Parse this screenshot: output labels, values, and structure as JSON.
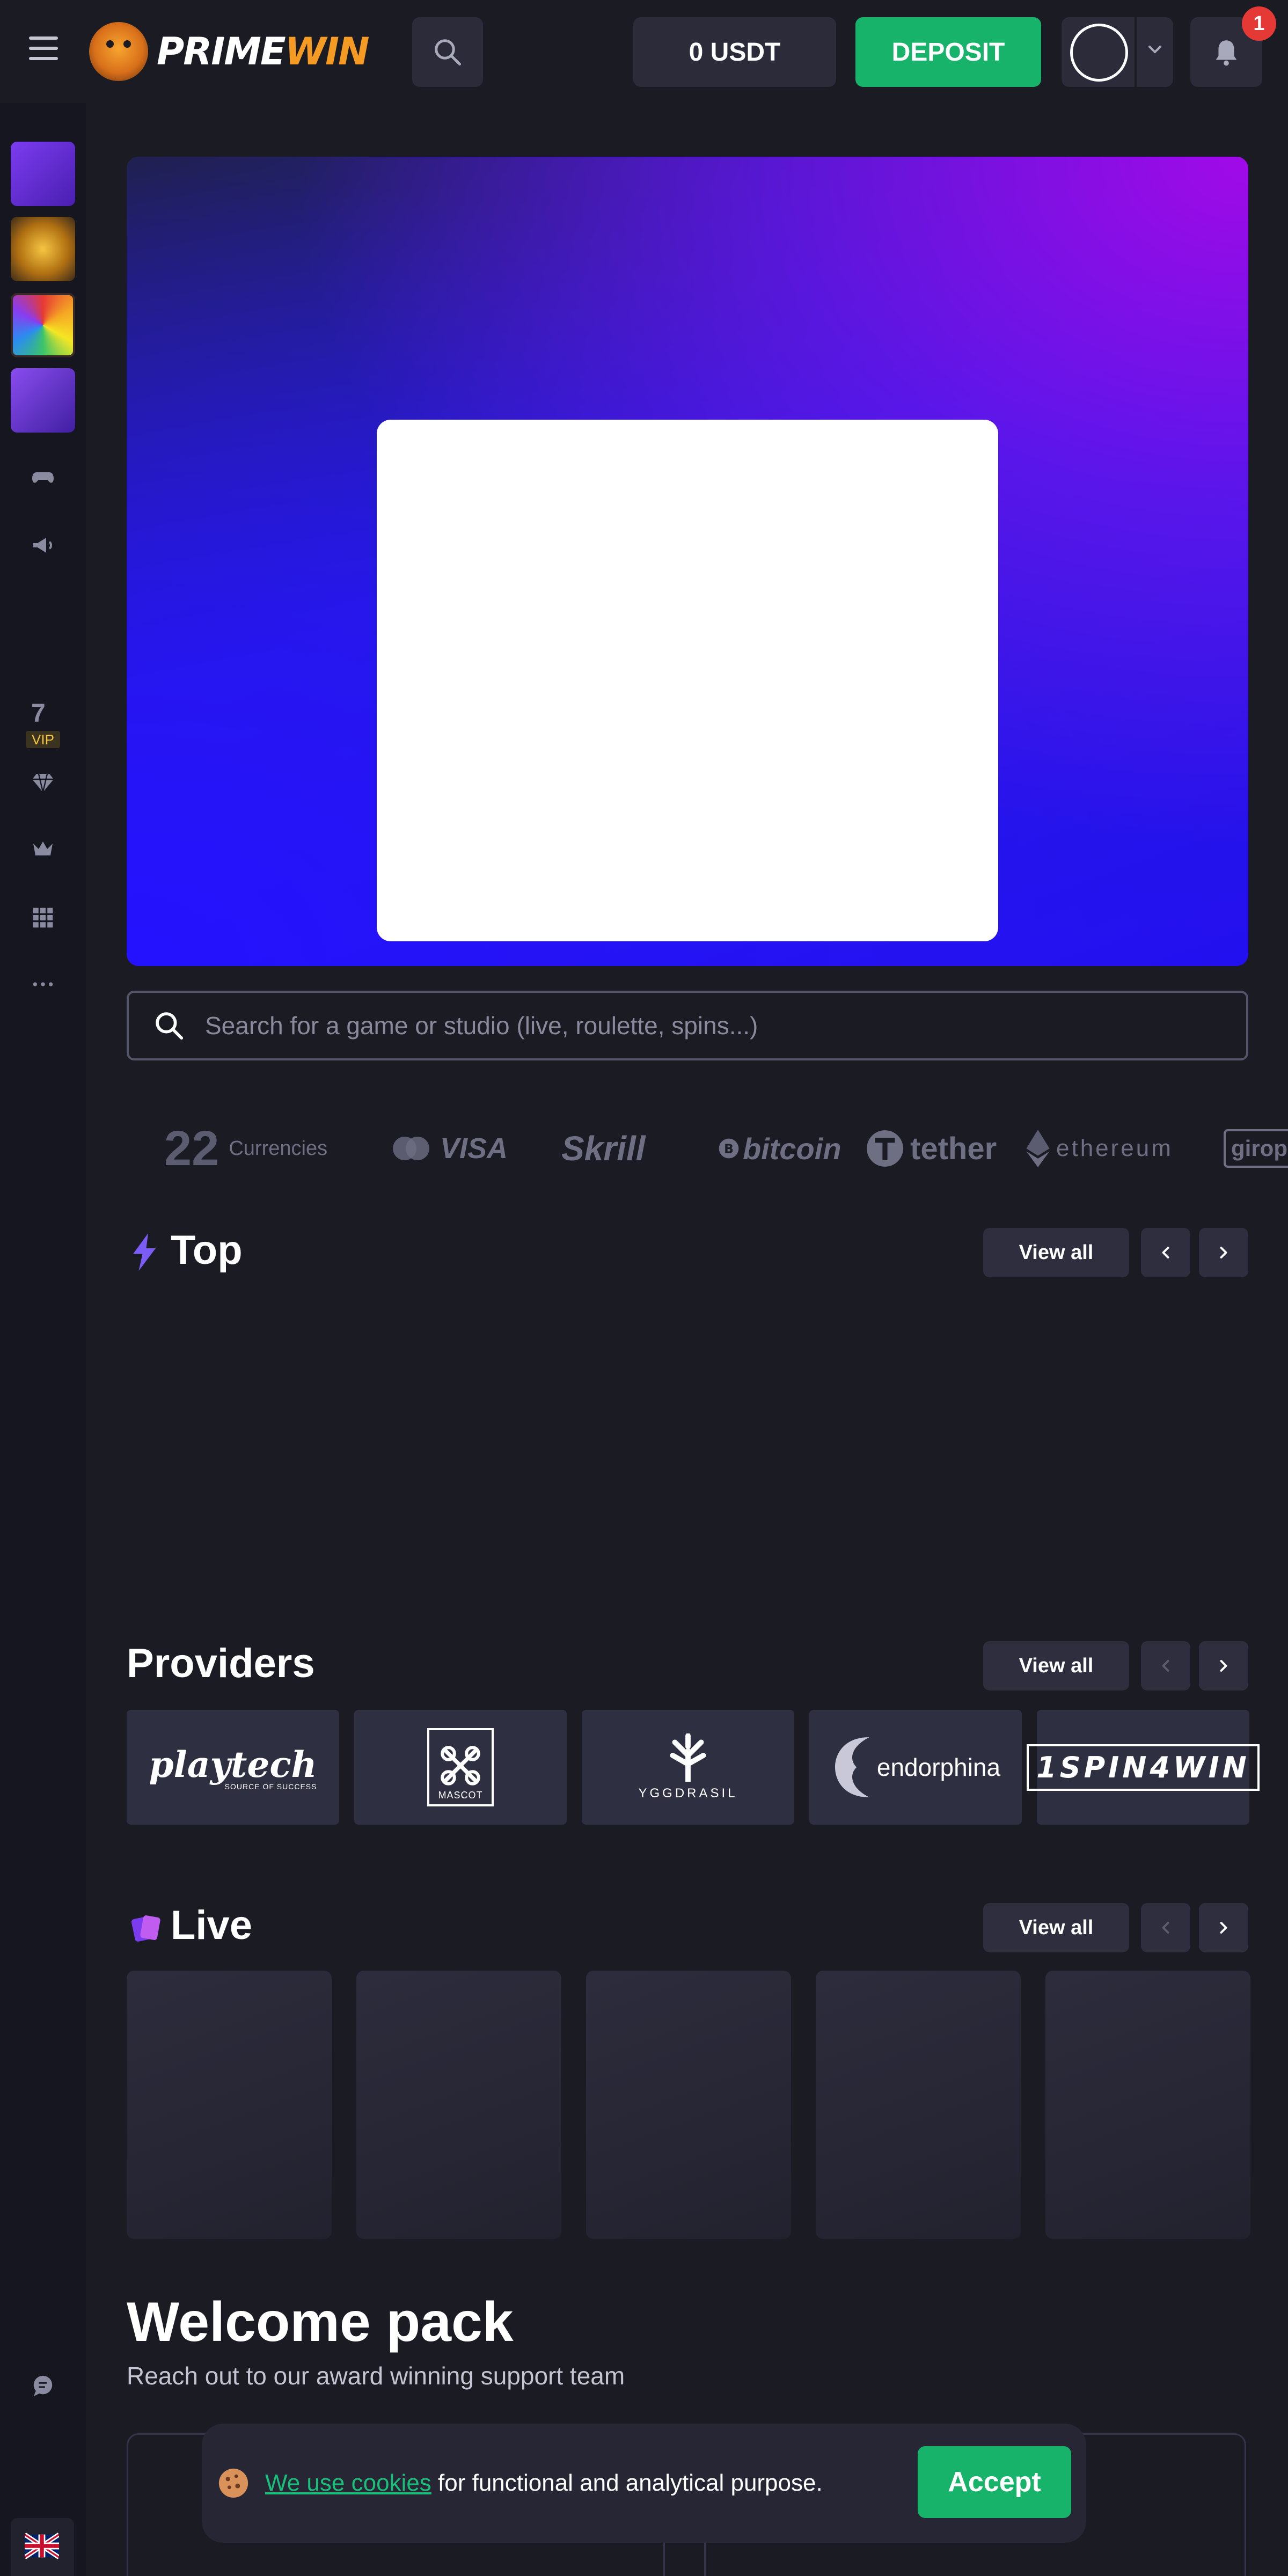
{
  "header": {
    "logo_prime": "PRIME",
    "logo_win": "WIN",
    "balance": "0 USDT",
    "deposit_label": "DEPOSIT",
    "notification_count": "1"
  },
  "sidebar": {
    "vip_number": "7",
    "vip_label": "VIP",
    "icons": [
      "gamepad-icon",
      "megaphone-icon",
      "vip-icon",
      "diamond-icon",
      "crown-icon",
      "grid-icon",
      "more-icon",
      "chat-icon",
      "uk-flag-icon",
      "settings-icon"
    ]
  },
  "search": {
    "placeholder": "Search for a game or studio (live, roulette, spins...)"
  },
  "payments": {
    "currency_count": "22",
    "currency_label": "Currencies",
    "visa": "VISA",
    "skrill": "Skrill",
    "bitcoin": "bitcoin",
    "tether": "tether",
    "ethereum": "ethereum",
    "giropay": "giropay"
  },
  "sections": {
    "top": {
      "title": "Top",
      "view_all": "View all"
    },
    "providers": {
      "title": "Providers",
      "view_all": "View all"
    },
    "live": {
      "title": "Live",
      "view_all": "View all"
    }
  },
  "providers": [
    {
      "name": "playtech",
      "tagline": "SOURCE OF SUCCESS"
    },
    {
      "name": "MASCOT"
    },
    {
      "name": "YGGDRASIL"
    },
    {
      "name": "endorphina"
    },
    {
      "name": "1SPIN4WIN"
    }
  ],
  "welcome": {
    "title": "Welcome pack",
    "subtitle": "Reach out to our award winning support team"
  },
  "cookie": {
    "link_text": "We use cookies",
    "text": " for functional and analytical purpose.",
    "accept_label": "Accept"
  },
  "colors": {
    "background": "#1b1b24",
    "accent_green": "#17b36a",
    "brand_orange": "#f59a23",
    "badge_red": "#e53935"
  }
}
